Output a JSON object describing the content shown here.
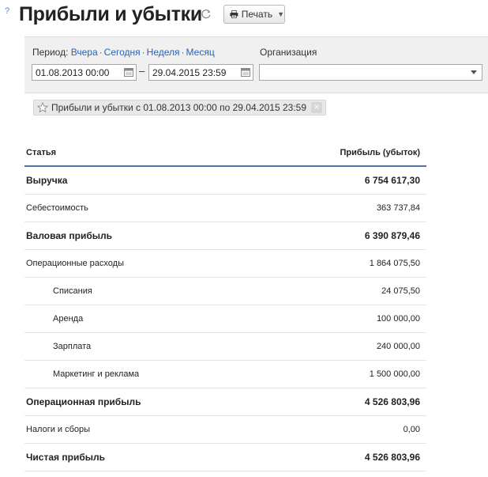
{
  "header": {
    "help": "?",
    "title": "Прибыли и убытки",
    "print_label": "Печать"
  },
  "filters": {
    "period_label": "Период:",
    "quick_links": [
      "Вчера",
      "Сегодня",
      "Неделя",
      "Месяц"
    ],
    "date_from": "01.08.2013 00:00",
    "date_separator": "–",
    "date_to": "29.04.2015 23:59",
    "organization_label": "Организация",
    "organization_value": ""
  },
  "tag": {
    "label": "Прибыли и убытки с 01.08.2013 00:00 по 29.04.2015 23:59"
  },
  "table": {
    "col_article": "Статья",
    "col_profit": "Прибыль (убыток)",
    "rows": [
      {
        "name": "Выручка",
        "value": "6 754 617,30",
        "style": "bold"
      },
      {
        "name": "Себестоимость",
        "value": "363 737,84",
        "style": "normal"
      },
      {
        "name": "Валовая прибыль",
        "value": "6 390 879,46",
        "style": "bold"
      },
      {
        "name": "Операционные расходы",
        "value": "1 864 075,50",
        "style": "normal"
      },
      {
        "name": "Списания",
        "value": "24 075,50",
        "style": "sub"
      },
      {
        "name": "Аренда",
        "value": "100 000,00",
        "style": "sub"
      },
      {
        "name": "Зарплата",
        "value": "240 000,00",
        "style": "sub"
      },
      {
        "name": "Маркетинг и реклама",
        "value": "1 500 000,00",
        "style": "sub"
      },
      {
        "name": "Операционная прибыль",
        "value": "4 526 803,96",
        "style": "bold"
      },
      {
        "name": "Налоги и сборы",
        "value": "0,00",
        "style": "normal"
      },
      {
        "name": "Чистая прибыль",
        "value": "4 526 803,96",
        "style": "bold"
      }
    ]
  },
  "colors": {
    "link": "#2864b4",
    "header_rule": "#4f76a8",
    "filter_bg": "#f0f0f0"
  }
}
